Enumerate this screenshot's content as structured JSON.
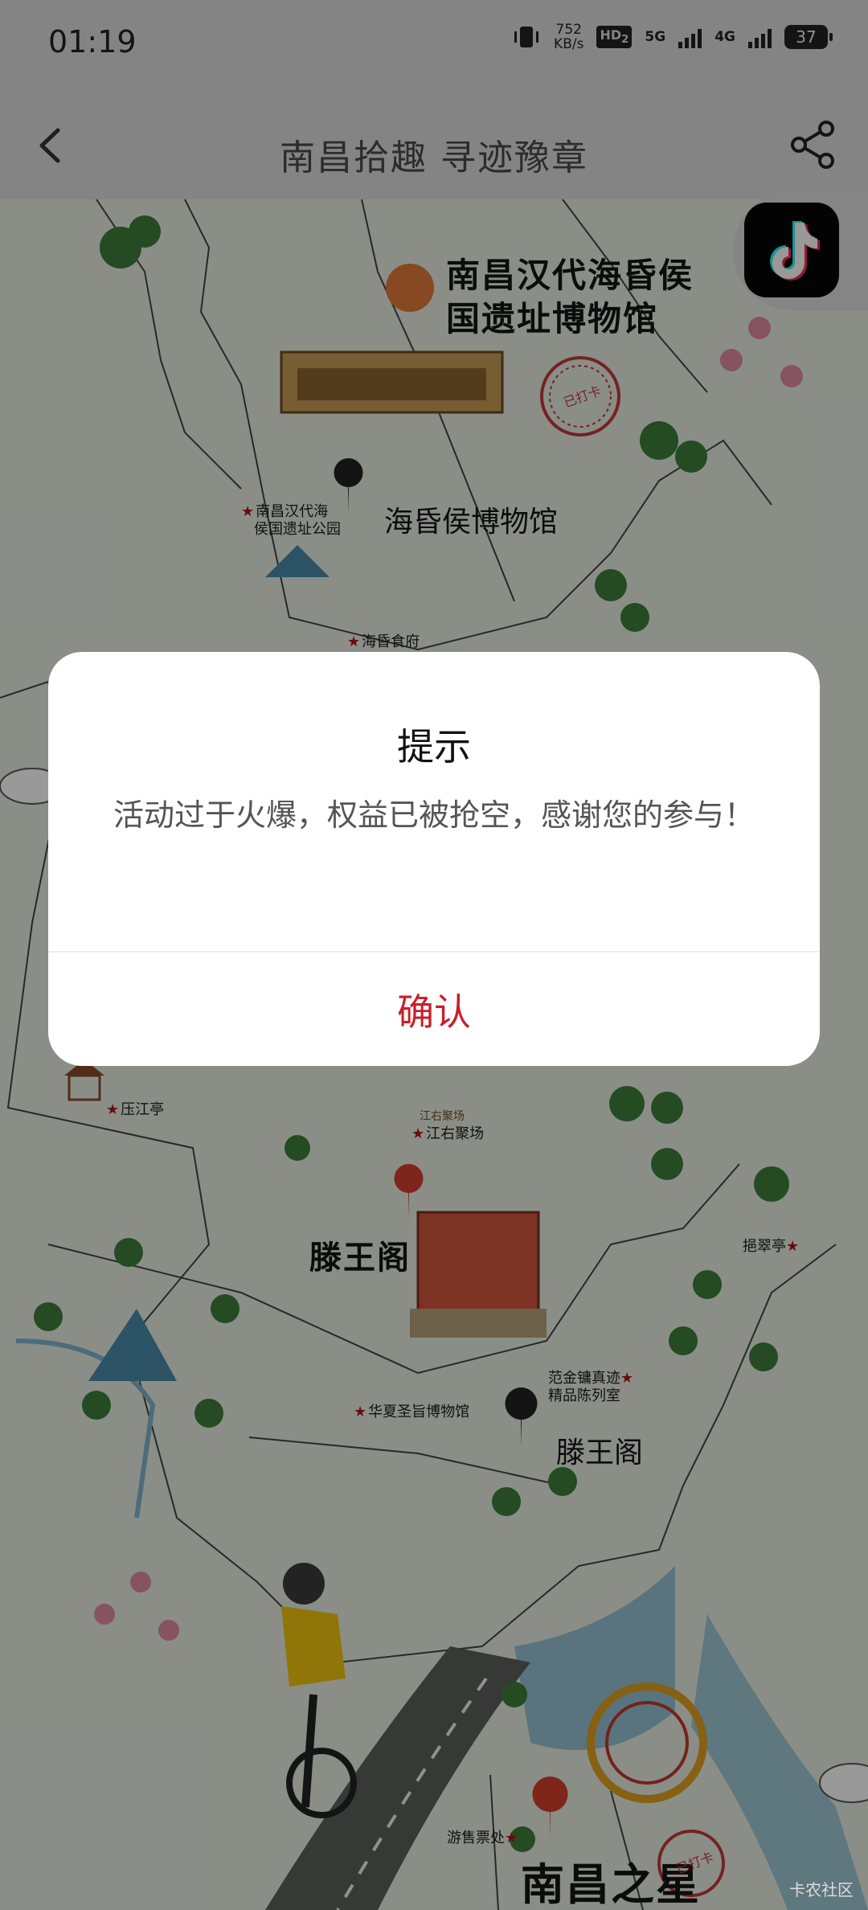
{
  "status": {
    "time": "01:19",
    "net_speed_value": "752",
    "net_speed_unit": "KB/s",
    "hd_label": "HD",
    "hd_sub": "2",
    "network_5g": "5G",
    "network_4g": "4G",
    "battery": "37"
  },
  "header": {
    "title": "南昌拾趣 寻迹豫章",
    "back_icon": "chevron-left-icon",
    "share_icon": "share-icon"
  },
  "map": {
    "museum_title_line1": "南昌汉代海昏侯",
    "museum_title_line2": "国遗址博物馆",
    "stamp_text": "已打卡",
    "museum_pin_label": "海昏侯博物馆",
    "park_label_line1": "南昌汉代海",
    "park_label_line2": "侯国遗址公园",
    "food_label": "海昏食府",
    "pavilion_label": "压江亭",
    "gathering_label": "江右聚场",
    "gathering_sign": "江右聚场",
    "tengwang_title": "滕王阁",
    "pavilion2_label": "挹翠亭",
    "fan_label_line1": "范金镛真迹",
    "fan_label_line2": "精品陈列室",
    "huaxia_label": "华夏圣旨博物馆",
    "tengwang_pin_label": "滕王阁",
    "ticket_label": "游售票处",
    "nanchang_star_title": "南昌之星",
    "stamp2_text": "已打卡"
  },
  "dialog": {
    "title": "提示",
    "message": "活动过于火爆，权益已被抢空，感谢您的参与！",
    "confirm_label": "确认"
  },
  "watermark": "卡农社区",
  "colors": {
    "accent_red": "#c8202a",
    "overlay": "rgba(0,0,0,0.4)",
    "map_base": "#e6ede2"
  }
}
